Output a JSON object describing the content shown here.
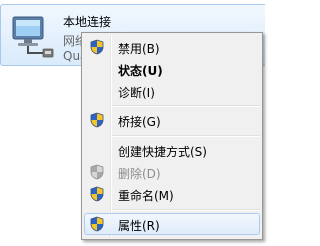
{
  "adapter": {
    "name": "本地连接",
    "status_partial": "网络",
    "device_partial": "Qua",
    "icon": "network-adapter-icon"
  },
  "menu": {
    "items": [
      {
        "label": "禁用(B)",
        "icon": "uac-shield-icon",
        "enabled": true,
        "bold": false
      },
      {
        "label": "状态(U)",
        "icon": null,
        "enabled": true,
        "bold": true
      },
      {
        "label": "诊断(I)",
        "icon": null,
        "enabled": true,
        "bold": false
      },
      {
        "label": "桥接(G)",
        "icon": "uac-shield-icon",
        "enabled": true,
        "bold": false
      },
      {
        "label": "创建快捷方式(S)",
        "icon": null,
        "enabled": true,
        "bold": false
      },
      {
        "label": "删除(D)",
        "icon": "uac-shield-icon",
        "enabled": false,
        "bold": false
      },
      {
        "label": "重命名(M)",
        "icon": "uac-shield-icon",
        "enabled": true,
        "bold": false
      },
      {
        "label": "属性(R)",
        "icon": "uac-shield-icon",
        "enabled": true,
        "bold": false,
        "highlighted": true
      }
    ]
  },
  "colors": {
    "menu_background": "#f0f0f0",
    "menu_border": "#979797",
    "highlight_border": "#aeccf1",
    "tile_border": "#a9c9ec",
    "disabled_text": "#8d8d8d",
    "shield_blue": "#2b64c6",
    "shield_yellow": "#f3c623"
  }
}
